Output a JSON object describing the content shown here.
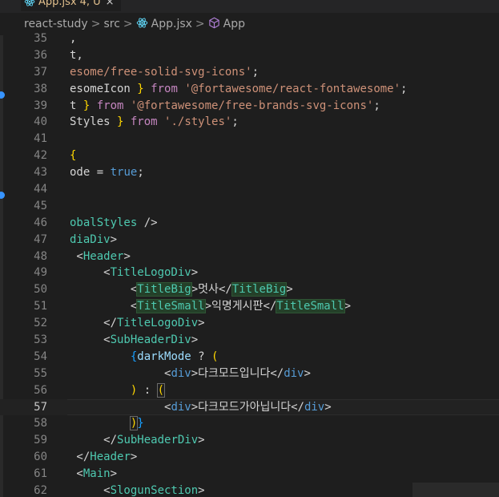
{
  "tab": {
    "file": "App.jsx",
    "status": "4, U",
    "close_glyph": "×"
  },
  "breadcrumb": {
    "items": [
      "react-study",
      "src",
      "App.jsx",
      "App"
    ],
    "separator": ">"
  },
  "colors": {
    "keyword": "#c586c0",
    "string": "#ce9178",
    "tag": "#4ec9b0",
    "punctuation": "#808080",
    "variable": "#9cdcfe",
    "constant": "#569cd6",
    "bracket_gold": "#ffd700",
    "bracket_pink": "#da70d6",
    "bracket_blue": "#179fff",
    "line_number": "#858585",
    "accent": "#3794ff"
  },
  "editor": {
    "current_line": 57,
    "lines": [
      {
        "n": 35,
        "tokens": [
          {
            "t": ",",
            "c": "text"
          }
        ]
      },
      {
        "n": 36,
        "tokens": [
          {
            "t": "t,",
            "c": "text"
          }
        ]
      },
      {
        "n": 37,
        "tokens": [
          {
            "t": "esome/free-solid-svg-icons'",
            "c": "string"
          },
          {
            "t": ";",
            "c": "text"
          }
        ]
      },
      {
        "n": 38,
        "tokens": [
          {
            "t": "esomeIcon ",
            "c": "text"
          },
          {
            "t": "}",
            "c": "gold"
          },
          {
            "t": " from ",
            "c": "keyword"
          },
          {
            "t": "'@fortawesome/react-fontawesome'",
            "c": "string"
          },
          {
            "t": ";",
            "c": "text"
          }
        ]
      },
      {
        "n": 39,
        "tokens": [
          {
            "t": "t ",
            "c": "text"
          },
          {
            "t": "}",
            "c": "gold"
          },
          {
            "t": " from ",
            "c": "keyword"
          },
          {
            "t": "'@fortawesome/free-brands-svg-icons'",
            "c": "string"
          },
          {
            "t": ";",
            "c": "text"
          }
        ]
      },
      {
        "n": 40,
        "tokens": [
          {
            "t": "Styles ",
            "c": "text"
          },
          {
            "t": "}",
            "c": "gold"
          },
          {
            "t": " from ",
            "c": "keyword"
          },
          {
            "t": "'./styles'",
            "c": "string"
          },
          {
            "t": ";",
            "c": "text"
          }
        ]
      },
      {
        "n": 41,
        "tokens": []
      },
      {
        "n": 42,
        "tokens": [
          {
            "t": "{",
            "c": "gold"
          }
        ]
      },
      {
        "n": 43,
        "tokens": [
          {
            "t": "ode ",
            "c": "text"
          },
          {
            "t": "=",
            "c": "text"
          },
          {
            "t": " true",
            "c": "constant"
          },
          {
            "t": ";",
            "c": "text"
          }
        ]
      },
      {
        "n": 44,
        "tokens": []
      },
      {
        "n": 45,
        "tokens": []
      },
      {
        "n": 46,
        "tokens": [
          {
            "t": "obalStyles",
            "c": "tag"
          },
          {
            "t": " />",
            "c": "text"
          }
        ]
      },
      {
        "n": 47,
        "tokens": [
          {
            "t": "diaDiv",
            "c": "tag"
          },
          {
            "t": ">",
            "c": "text"
          }
        ]
      },
      {
        "n": 48,
        "tokens": [
          {
            "t": " <",
            "c": "text"
          },
          {
            "t": "Header",
            "c": "tag"
          },
          {
            "t": ">",
            "c": "text"
          }
        ]
      },
      {
        "n": 49,
        "tokens": [
          {
            "t": "     <",
            "c": "text"
          },
          {
            "t": "TitleLogoDiv",
            "c": "tag"
          },
          {
            "t": ">",
            "c": "text"
          }
        ]
      },
      {
        "n": 50,
        "tokens": [
          {
            "t": "         <",
            "c": "text"
          },
          {
            "t": "TitleBig",
            "c": "tag-hl"
          },
          {
            "t": ">",
            "c": "text"
          },
          {
            "t": "멋사",
            "c": "text"
          },
          {
            "t": "</",
            "c": "text"
          },
          {
            "t": "TitleBig",
            "c": "tag-hl"
          },
          {
            "t": ">",
            "c": "text"
          }
        ]
      },
      {
        "n": 51,
        "tokens": [
          {
            "t": "         <",
            "c": "text"
          },
          {
            "t": "TitleSmall",
            "c": "tag-hl"
          },
          {
            "t": ">",
            "c": "text"
          },
          {
            "t": "익명게시판",
            "c": "text"
          },
          {
            "t": "</",
            "c": "text"
          },
          {
            "t": "TitleSmall",
            "c": "tag-hl"
          },
          {
            "t": ">",
            "c": "text"
          }
        ]
      },
      {
        "n": 52,
        "tokens": [
          {
            "t": "     </",
            "c": "text"
          },
          {
            "t": "TitleLogoDiv",
            "c": "tag"
          },
          {
            "t": ">",
            "c": "text"
          }
        ]
      },
      {
        "n": 53,
        "tokens": [
          {
            "t": "     <",
            "c": "text"
          },
          {
            "t": "SubHeaderDiv",
            "c": "tag"
          },
          {
            "t": ">",
            "c": "text"
          }
        ]
      },
      {
        "n": 54,
        "tokens": [
          {
            "t": "         ",
            "c": "text"
          },
          {
            "t": "{",
            "c": "blue"
          },
          {
            "t": "darkMode",
            "c": "variable"
          },
          {
            "t": " ? ",
            "c": "text"
          },
          {
            "t": "(",
            "c": "gold"
          }
        ]
      },
      {
        "n": 55,
        "tokens": [
          {
            "t": "              <",
            "c": "text"
          },
          {
            "t": "div",
            "c": "constant"
          },
          {
            "t": ">",
            "c": "text"
          },
          {
            "t": "다크모드입니다",
            "c": "text"
          },
          {
            "t": "</",
            "c": "text"
          },
          {
            "t": "div",
            "c": "constant"
          },
          {
            "t": ">",
            "c": "text"
          }
        ]
      },
      {
        "n": 56,
        "tokens": [
          {
            "t": "         ",
            "c": "text"
          },
          {
            "t": ")",
            "c": "gold"
          },
          {
            "t": " : ",
            "c": "text"
          },
          {
            "t": "(",
            "c": "gold-box"
          }
        ]
      },
      {
        "n": 57,
        "tokens": [
          {
            "t": "              <",
            "c": "text"
          },
          {
            "t": "div",
            "c": "constant"
          },
          {
            "t": ">",
            "c": "text"
          },
          {
            "t": "다크모드가아닙니다",
            "c": "text"
          },
          {
            "t": "</",
            "c": "text"
          },
          {
            "t": "div",
            "c": "constant"
          },
          {
            "t": ">",
            "c": "text"
          }
        ]
      },
      {
        "n": 58,
        "tokens": [
          {
            "t": "         ",
            "c": "text"
          },
          {
            "t": ")",
            "c": "gold-box"
          },
          {
            "t": "}",
            "c": "blue"
          }
        ]
      },
      {
        "n": 59,
        "tokens": [
          {
            "t": "     </",
            "c": "text"
          },
          {
            "t": "SubHeaderDiv",
            "c": "tag"
          },
          {
            "t": ">",
            "c": "text"
          }
        ]
      },
      {
        "n": 60,
        "tokens": [
          {
            "t": " </",
            "c": "text"
          },
          {
            "t": "Header",
            "c": "tag"
          },
          {
            "t": ">",
            "c": "text"
          }
        ]
      },
      {
        "n": 61,
        "tokens": [
          {
            "t": " <",
            "c": "text"
          },
          {
            "t": "Main",
            "c": "tag"
          },
          {
            "t": ">",
            "c": "text"
          }
        ]
      },
      {
        "n": 62,
        "tokens": [
          {
            "t": "     <",
            "c": "text"
          },
          {
            "t": "SlogunSection",
            "c": "tag"
          },
          {
            "t": ">",
            "c": "text"
          }
        ]
      }
    ]
  }
}
